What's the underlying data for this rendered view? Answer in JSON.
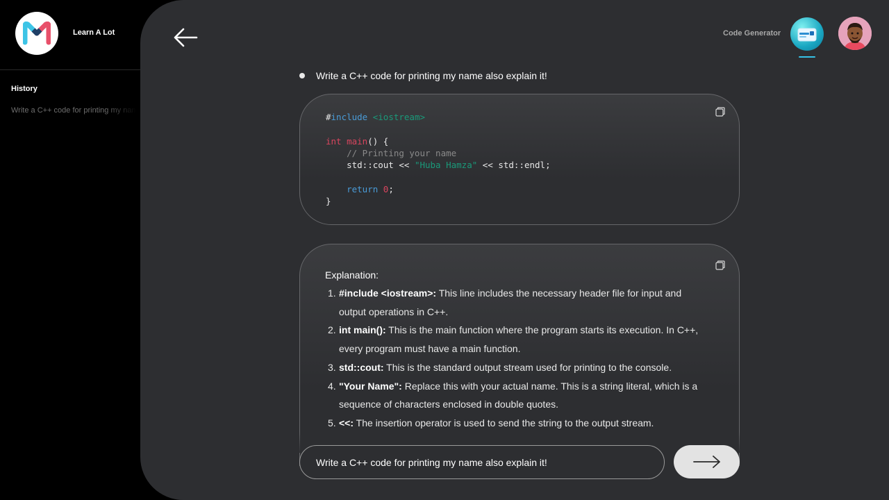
{
  "app": {
    "name": "Learn A Lot",
    "logo_icon": "brand-logo-icon"
  },
  "sidebar": {
    "history_title": "History",
    "history_items": [
      "Write a C++ code for printing my name also explain it!"
    ]
  },
  "header": {
    "back_icon": "arrow-left-icon",
    "title": "Code Generator",
    "tool_icon": "code-generator-icon",
    "user_icon": "user-avatar"
  },
  "conversation": {
    "prompt": "Write a C++ code for printing my name also explain it!",
    "code": {
      "line1_hash": "#",
      "line1_include": "include",
      "line1_header": "<iostream>",
      "line3_int": "int",
      "line3_main": "main",
      "line3_rest": "() {",
      "comment": "    // Printing your name",
      "cout_pre": "    std::cout << ",
      "cout_str": "\"Huba Hamza\"",
      "cout_post": " << std::endl;",
      "return_kw": "    return",
      "return_val": "0",
      "return_semi": ";",
      "close": "}"
    },
    "explanation": {
      "title": "Explanation:",
      "items": [
        {
          "num": "1.",
          "term": "#include <iostream>:",
          "text": " This line includes the necessary header file for input and output operations in C++."
        },
        {
          "num": "2.",
          "term": "int main():",
          "text": " This is the main function where the program starts its execution. In C++, every program must have a main function."
        },
        {
          "num": "3.",
          "term": "std::cout:",
          "text": " This is the standard output stream used for printing to the console."
        },
        {
          "num": "4.",
          "term": "\"Your Name\":",
          "text": " Replace this with your actual name. This is a string literal, which is a sequence of characters enclosed in double quotes."
        },
        {
          "num": "5.",
          "term": "<<:",
          "text": " The insertion operator is used to send the string to the output stream."
        }
      ]
    }
  },
  "composer": {
    "value": "Write a C++ code for printing my name also explain it!",
    "send_icon": "arrow-right-icon"
  },
  "colors": {
    "background": "#000000",
    "panel": "#2d2e31",
    "keyword_blue": "#4a9cd8",
    "keyword_red": "#d8455e",
    "string_green": "#1a9a7a",
    "send_button": "#e3e3e3"
  }
}
